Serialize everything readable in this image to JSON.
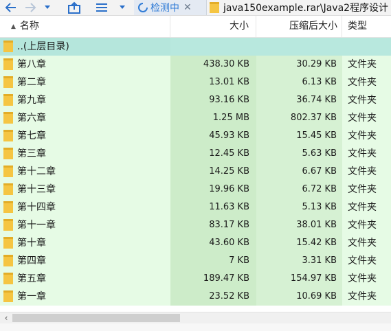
{
  "toolbar": {
    "back_icon": "arrow-left-icon",
    "forward_icon": "arrow-right-icon",
    "history_icon": "chevron-down-icon",
    "up_icon": "folder-up-icon",
    "view_icon": "list-view-icon",
    "view_menu_icon": "chevron-down-icon"
  },
  "tabs": {
    "status_label": "检测中",
    "status_icon": "spinner-icon",
    "close_icon": "close-icon",
    "path_label": "java150example.rar\\Java2程序设计"
  },
  "columns": {
    "name": "名称",
    "size": "大小",
    "packed": "压缩后大小",
    "type": "类型"
  },
  "parent_row": {
    "name": "..(上层目录)"
  },
  "files": [
    {
      "name": "第八章",
      "size": "438.30 KB",
      "packed": "30.29 KB",
      "type": "文件夹"
    },
    {
      "name": "第二章",
      "size": "13.01 KB",
      "packed": "6.13 KB",
      "type": "文件夹"
    },
    {
      "name": "第九章",
      "size": "93.16 KB",
      "packed": "36.74 KB",
      "type": "文件夹"
    },
    {
      "name": "第六章",
      "size": "1.25 MB",
      "packed": "802.37 KB",
      "type": "文件夹"
    },
    {
      "name": "第七章",
      "size": "45.93 KB",
      "packed": "15.45 KB",
      "type": "文件夹"
    },
    {
      "name": "第三章",
      "size": "12.45 KB",
      "packed": "5.63 KB",
      "type": "文件夹"
    },
    {
      "name": "第十二章",
      "size": "14.25 KB",
      "packed": "6.67 KB",
      "type": "文件夹"
    },
    {
      "name": "第十三章",
      "size": "19.96 KB",
      "packed": "6.72 KB",
      "type": "文件夹"
    },
    {
      "name": "第十四章",
      "size": "11.63 KB",
      "packed": "5.13 KB",
      "type": "文件夹"
    },
    {
      "name": "第十一章",
      "size": "83.17 KB",
      "packed": "38.01 KB",
      "type": "文件夹"
    },
    {
      "name": "第十章",
      "size": "43.60 KB",
      "packed": "15.42 KB",
      "type": "文件夹"
    },
    {
      "name": "第四章",
      "size": "7 KB",
      "packed": "3.31 KB",
      "type": "文件夹"
    },
    {
      "name": "第五章",
      "size": "189.47 KB",
      "packed": "154.97 KB",
      "type": "文件夹"
    },
    {
      "name": "第一章",
      "size": "23.52 KB",
      "packed": "10.69 KB",
      "type": "文件夹"
    }
  ],
  "scrollbar": {
    "left_icon": "chevron-left-icon"
  },
  "colors": {
    "accent": "#2a6fc9",
    "folder": "#f5c542",
    "name_column_bg": "#e6fbe5",
    "size_column_bg": "#cdecc9",
    "parent_row_bg": "#b5e6dc"
  }
}
